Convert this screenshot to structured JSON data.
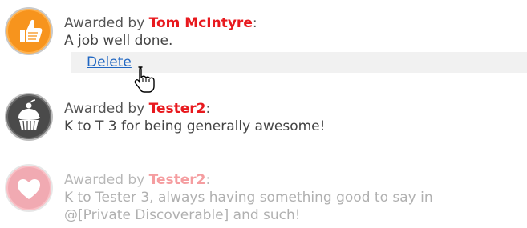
{
  "awards": [
    {
      "prefix": "Awarded by",
      "awarder": "Tom McIntyre",
      "colon": ":",
      "message": "A job well done.",
      "badge_icon": "thumbs-up-icon",
      "badge_color": "#f7941d",
      "delete_label": "Delete"
    },
    {
      "prefix": "Awarded by",
      "awarder": "Tester2",
      "colon": ":",
      "message": "K to T 3 for being generally awesome!",
      "badge_icon": "cupcake-icon",
      "badge_color": "#4a4a4a"
    },
    {
      "prefix": "Awarded by",
      "awarder": "Tester2",
      "colon": ":",
      "message": "K to Tester 3, always having something good to say in",
      "message_line2": "@[Private Discoverable] and such!",
      "badge_icon": "heart-icon",
      "badge_color": "#e0374a"
    }
  ],
  "colors": {
    "awarder_name": "#e8191e",
    "link": "#1f66c2",
    "action_bar_bg": "#f1f1f1"
  }
}
